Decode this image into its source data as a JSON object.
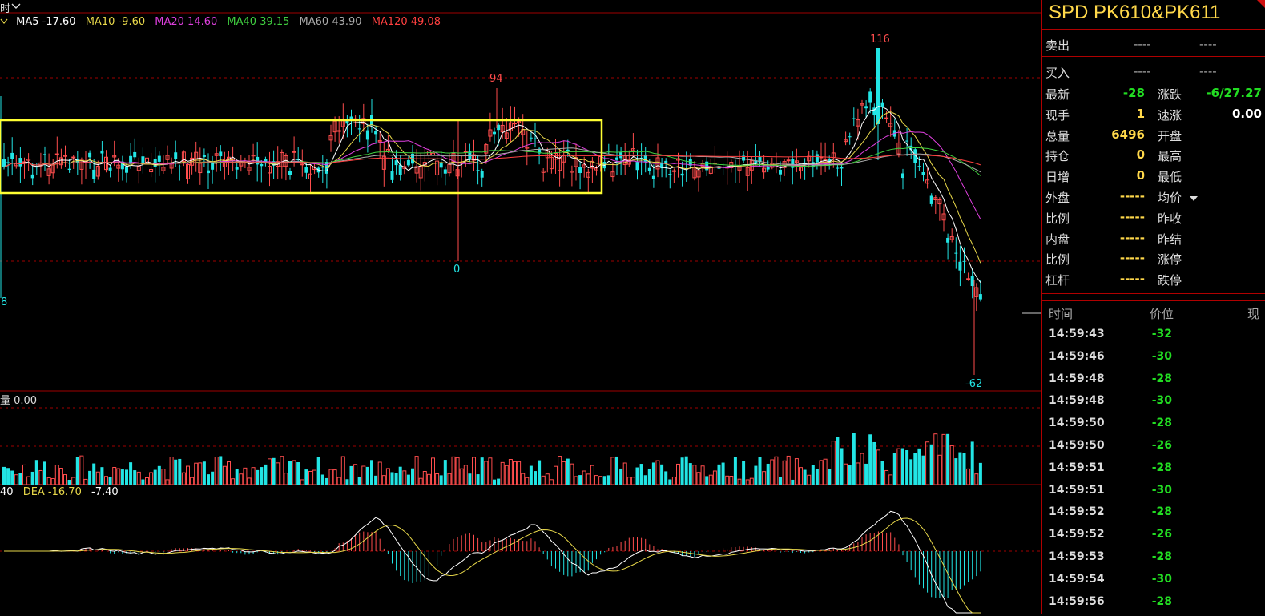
{
  "header": {
    "period_label": "时",
    "chevron_icon": "chevron-down-icon"
  },
  "ma_labels": [
    {
      "text": "MA5 -17.60",
      "color": "#ffffff"
    },
    {
      "text": "MA10 -9.60",
      "color": "#e8d84a"
    },
    {
      "text": "MA20 14.60",
      "color": "#e040e0"
    },
    {
      "text": "MA40 39.15",
      "color": "#40d040"
    },
    {
      "text": "MA60 43.90",
      "color": "#aaaaaa"
    },
    {
      "text": "MA120 49.08",
      "color": "#ff4040"
    }
  ],
  "price_annotations": {
    "high": "116",
    "high_mid": "94",
    "low_mid": "0",
    "low": "-62",
    "left_edge": "8"
  },
  "volume_label": "量 0.00",
  "macd_labels": [
    {
      "text": "40",
      "color": "#ffffff"
    },
    {
      "text": "DEA -16.70",
      "color": "#e8d84a"
    },
    {
      "text": "-7.40",
      "color": "#ffffff"
    }
  ],
  "colors": {
    "up": "#ff4d4d",
    "down": "#22e5e5",
    "box": "#ffff33",
    "grid": "#a00000",
    "green": "#22dd22",
    "yellow": "#ffd84a"
  },
  "panel": {
    "title": "SPD PK610&PK611",
    "sell": {
      "label": "卖出",
      "v1": "----",
      "v2": "----"
    },
    "buy": {
      "label": "买入",
      "v1": "----",
      "v2": "----"
    },
    "quote_rows": [
      {
        "l1": "最新",
        "v1": "-28",
        "c1": "#22dd22",
        "l2": "涨跌",
        "v2": "-6/27.27",
        "c2": "#22dd22"
      },
      {
        "l1": "现手",
        "v1": "1",
        "c1": "#ffd84a",
        "l2": "速涨",
        "v2": "0.00",
        "c2": "#ffffff"
      },
      {
        "l1": "总量",
        "v1": "6496",
        "c1": "#ffd84a",
        "l2": "开盘",
        "v2": "",
        "c2": "#ffffff"
      },
      {
        "l1": "持仓",
        "v1": "0",
        "c1": "#ffd84a",
        "l2": "最高",
        "v2": "",
        "c2": "#ffffff"
      },
      {
        "l1": "日增",
        "v1": "0",
        "c1": "#ffd84a",
        "l2": "最低",
        "v2": "",
        "c2": "#ffffff"
      },
      {
        "l1": "外盘",
        "v1": "-----",
        "c1": "#ffd84a",
        "l2": "均价",
        "v2": "",
        "c2": "#ffffff"
      },
      {
        "l1": "比例",
        "v1": "-----",
        "c1": "#ffd84a",
        "l2": "昨收",
        "v2": "",
        "c2": "#ffffff"
      },
      {
        "l1": "内盘",
        "v1": "-----",
        "c1": "#ffd84a",
        "l2": "昨结",
        "v2": "",
        "c2": "#ffffff"
      },
      {
        "l1": "比例",
        "v1": "-----",
        "c1": "#ffd84a",
        "l2": "涨停",
        "v2": "",
        "c2": "#ffffff"
      },
      {
        "l1": "杠杆",
        "v1": "-----",
        "c1": "#ffd84a",
        "l2": "跌停",
        "v2": "",
        "c2": "#ffffff"
      }
    ],
    "ticks_header": {
      "time": "时间",
      "price": "价位",
      "vol": "现"
    },
    "ticks": [
      {
        "time": "14:59:43",
        "price": "-32"
      },
      {
        "time": "14:59:46",
        "price": "-30"
      },
      {
        "time": "14:59:48",
        "price": "-28"
      },
      {
        "time": "14:59:48",
        "price": "-30"
      },
      {
        "time": "14:59:50",
        "price": "-28"
      },
      {
        "time": "14:59:50",
        "price": "-26"
      },
      {
        "time": "14:59:51",
        "price": "-28"
      },
      {
        "time": "14:59:51",
        "price": "-30"
      },
      {
        "time": "14:59:52",
        "price": "-28"
      },
      {
        "time": "14:59:52",
        "price": "-26"
      },
      {
        "time": "14:59:53",
        "price": "-28"
      },
      {
        "time": "14:59:54",
        "price": "-30"
      },
      {
        "time": "14:59:56",
        "price": "-28"
      }
    ]
  }
}
